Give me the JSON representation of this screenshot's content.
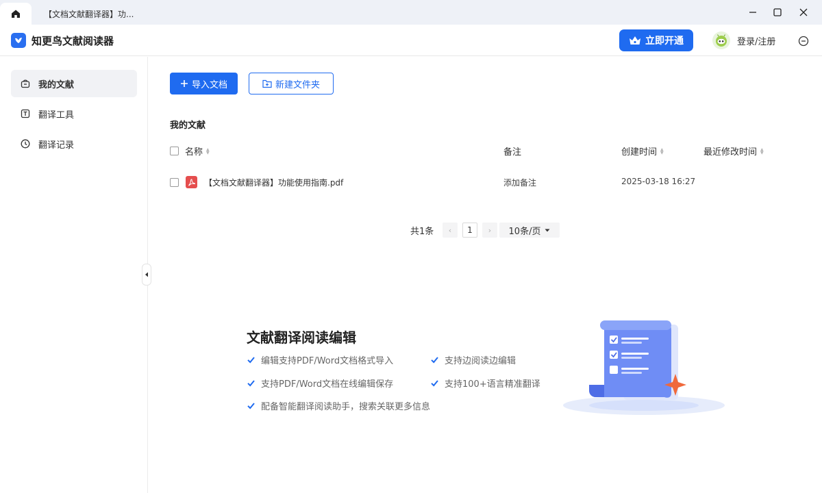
{
  "titlebar": {
    "home_icon": "home-icon",
    "doc_tab_title": "【文档文献翻译器】功..."
  },
  "header": {
    "app_name": "知更鸟文献阅读器",
    "vip_label": "立即开通",
    "login_label": "登录/注册"
  },
  "sidebar": {
    "items": [
      {
        "label": "我的文献",
        "icon": "bag-icon",
        "active": true
      },
      {
        "label": "翻译工具",
        "icon": "translate-icon",
        "active": false
      },
      {
        "label": "翻译记录",
        "icon": "clock-icon",
        "active": false
      }
    ]
  },
  "toolbar": {
    "import_label": "导入文档",
    "new_folder_label": "新建文件夹"
  },
  "main": {
    "section_title": "我的文献",
    "columns": {
      "name": "名称",
      "note": "备注",
      "created": "创建时间",
      "modified": "最近修改时间"
    },
    "rows": [
      {
        "name": "【文档文献翻译器】功能使用指南.pdf",
        "note": "添加备注",
        "created": "2025-03-18 16:27",
        "modified": ""
      }
    ]
  },
  "pagination": {
    "total": "共1条",
    "prev": "‹",
    "page": "1",
    "next": "›",
    "page_size": "10条/页"
  },
  "promo": {
    "title": "文献翻译阅读编辑",
    "features": [
      "编辑支持PDF/Word文档格式导入",
      "支持边阅读边编辑",
      "支持PDF/Word文档在线编辑保存",
      "支持100+语言精准翻译",
      "配备智能翻译阅读助手，搜索关联更多信息"
    ]
  },
  "colors": {
    "accent": "#1f6bf0",
    "pdf": "#e54e4e",
    "sidebar_active_bg": "#f1f2f5"
  }
}
